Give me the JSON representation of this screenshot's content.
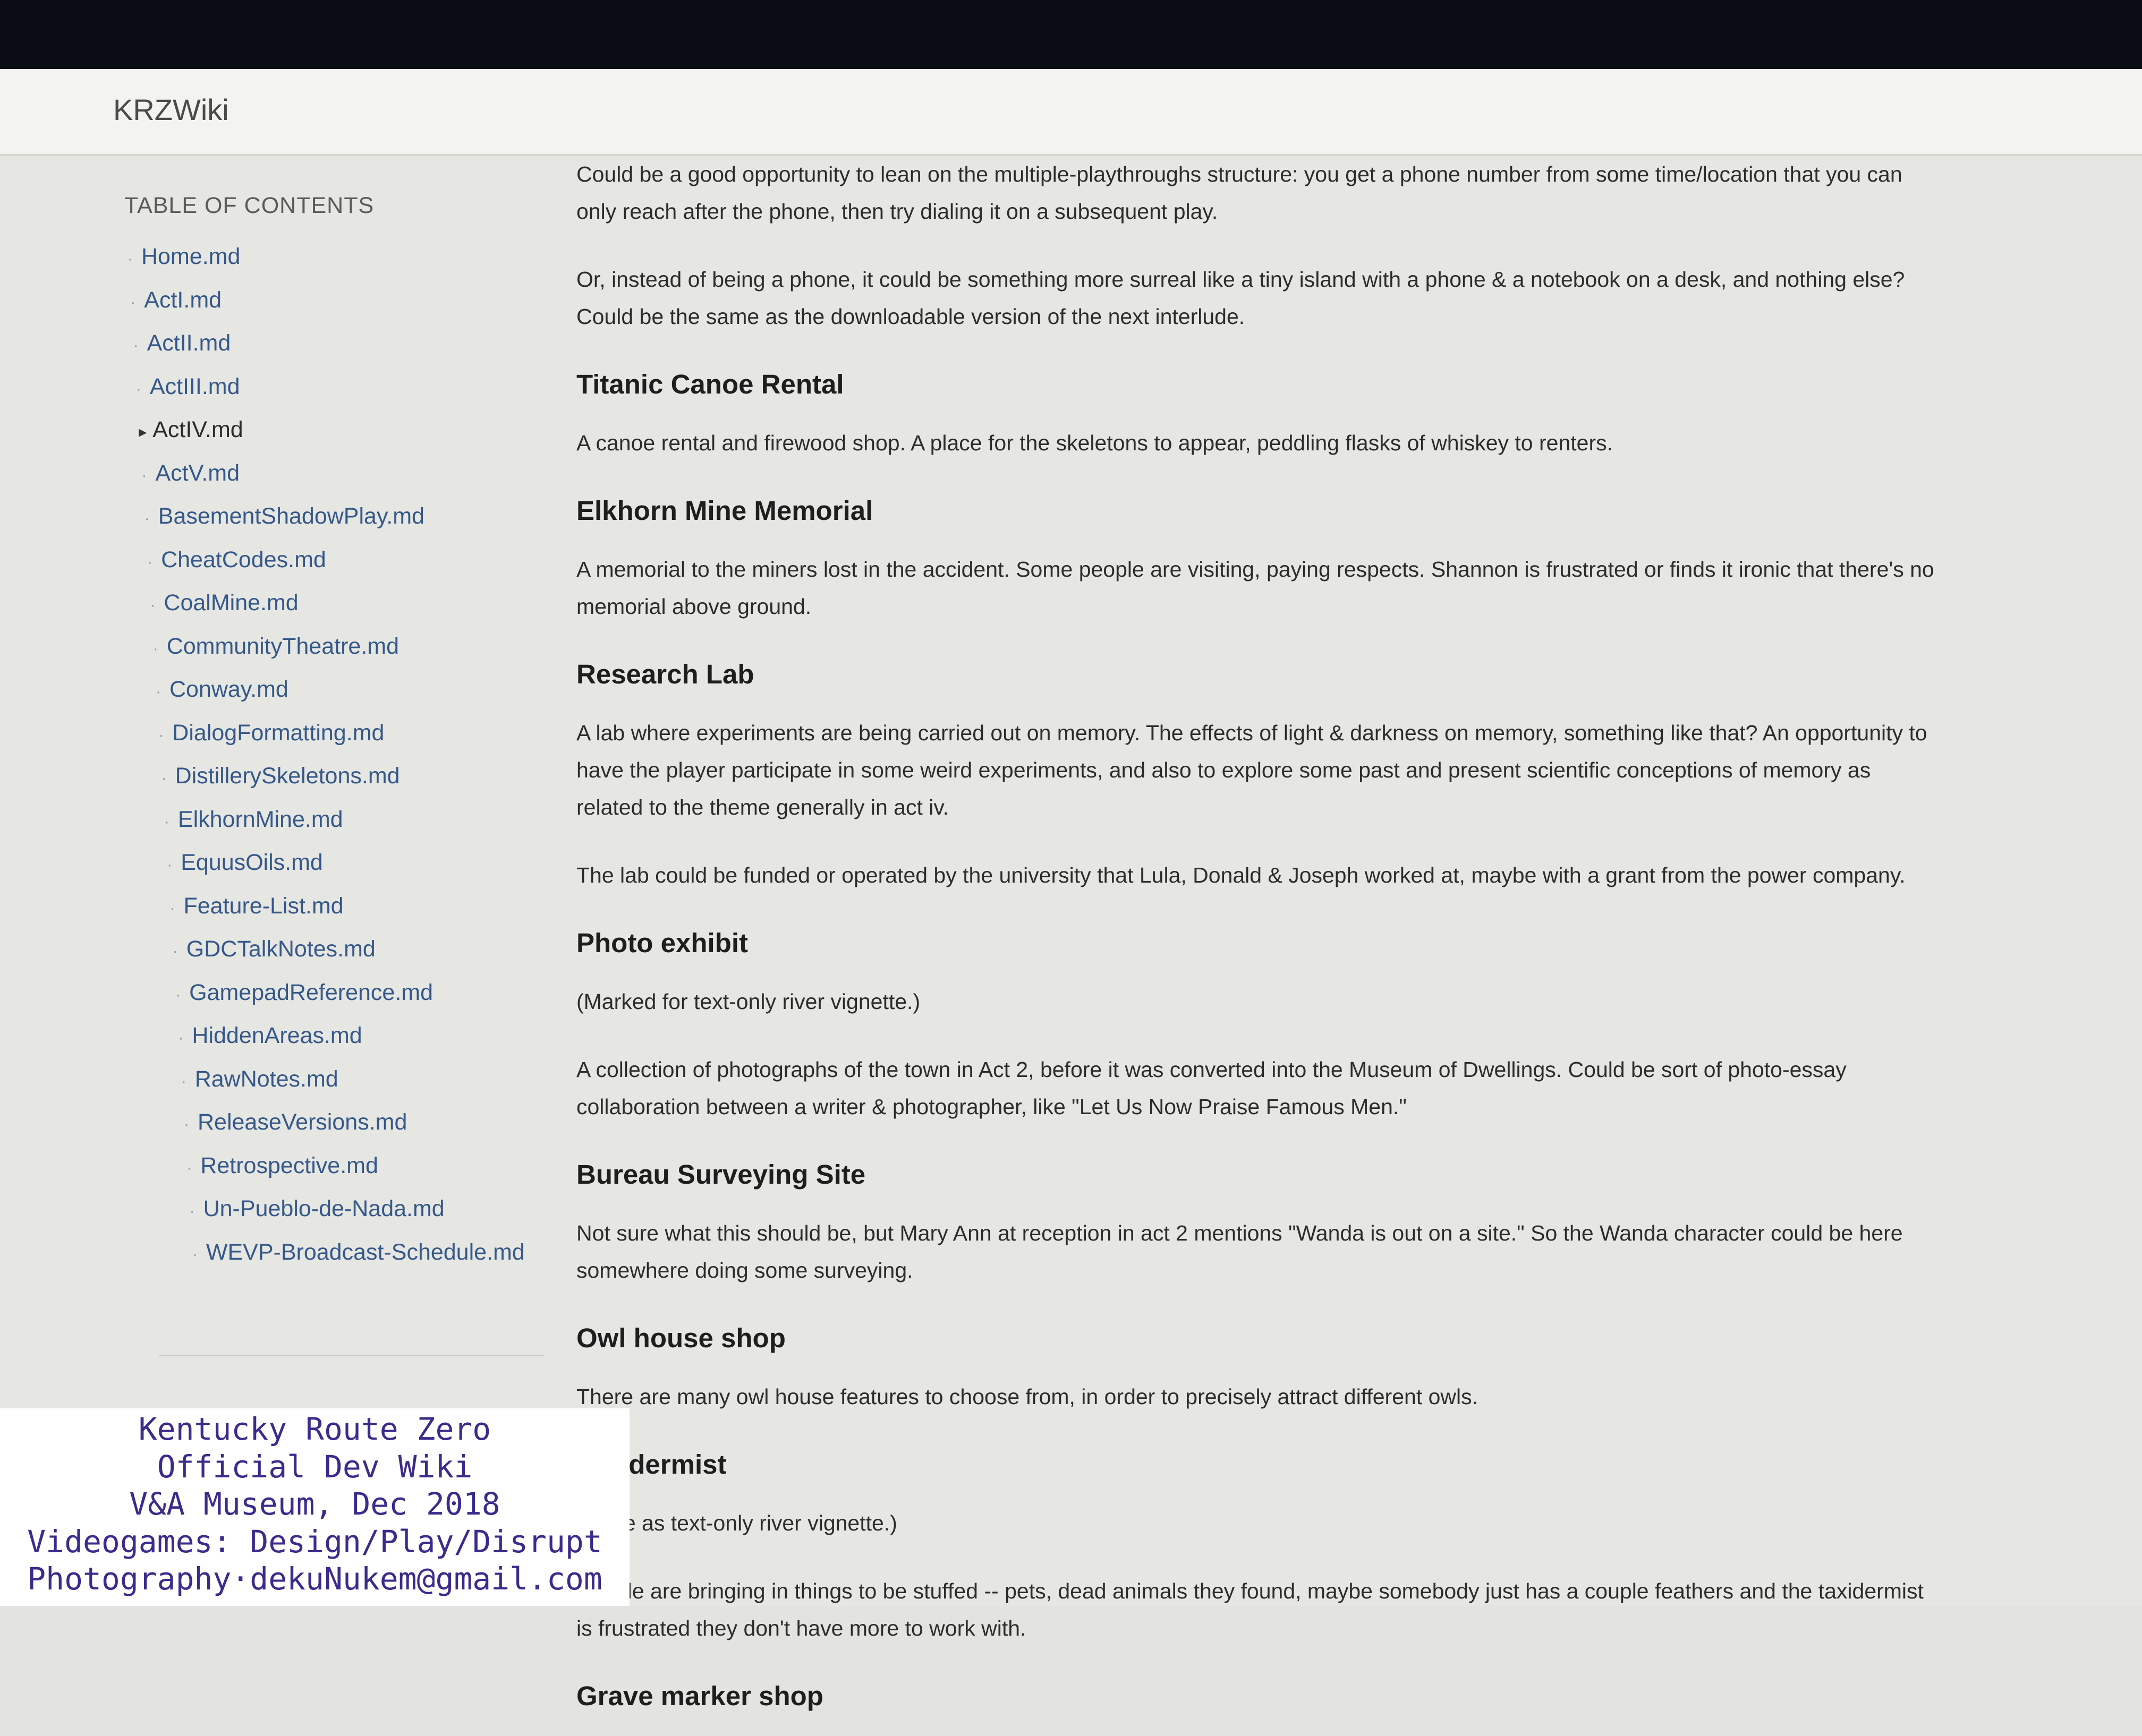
{
  "header": {
    "brand": "KRZWiki"
  },
  "sidebar": {
    "toc_heading": "TABLE OF CONTENTS",
    "items": [
      {
        "label": "Home.md"
      },
      {
        "label": "ActI.md"
      },
      {
        "label": "ActII.md"
      },
      {
        "label": "ActIII.md"
      },
      {
        "label": "ActIV.md",
        "active": true
      },
      {
        "label": "ActV.md"
      },
      {
        "label": "BasementShadowPlay.md"
      },
      {
        "label": "CheatCodes.md"
      },
      {
        "label": "CoalMine.md"
      },
      {
        "label": "CommunityTheatre.md"
      },
      {
        "label": "Conway.md"
      },
      {
        "label": "DialogFormatting.md"
      },
      {
        "label": "DistillerySkeletons.md"
      },
      {
        "label": "ElkhornMine.md"
      },
      {
        "label": "EquusOils.md"
      },
      {
        "label": "Feature-List.md"
      },
      {
        "label": "GDCTalkNotes.md"
      },
      {
        "label": "GamepadReference.md"
      },
      {
        "label": "HiddenAreas.md"
      },
      {
        "label": "RawNotes.md"
      },
      {
        "label": "ReleaseVersions.md"
      },
      {
        "label": "Retrospective.md"
      },
      {
        "label": "Un-Pueblo-de-Nada.md"
      },
      {
        "label": "WEVP-Broadcast-Schedule.md"
      }
    ]
  },
  "content": {
    "intro_p1": "Could be a good opportunity to lean on the multiple-playthroughs structure: you get a phone number from some time/location that you can only reach after the phone, then try dialing it on a subsequent play.",
    "intro_p2": "Or, instead of being a phone, it could be something more surreal like a tiny island with a phone & a notebook on a desk, and nothing else? Could be the same as the downloadable version of the next interlude.",
    "sections": [
      {
        "title": "Titanic Canoe Rental",
        "paragraphs": [
          "A canoe rental and firewood shop. A place for the skeletons to appear, peddling flasks of whiskey to renters."
        ]
      },
      {
        "title": "Elkhorn Mine Memorial",
        "paragraphs": [
          "A memorial to the miners lost in the accident. Some people are visiting, paying respects. Shannon is frustrated or finds it ironic that there's no memorial above ground."
        ]
      },
      {
        "title": "Research Lab",
        "paragraphs": [
          "A lab where experiments are being carried out on memory. The effects of light & darkness on memory, something like that? An opportunity to have the player participate in some weird experiments, and also to explore some past and present scientific conceptions of memory as related to the theme generally in act iv.",
          "The lab could be funded or operated by the university that Lula, Donald & Joseph worked at, maybe with a grant from the power company."
        ]
      },
      {
        "title": "Photo exhibit",
        "paragraphs": [
          "(Marked for text-only river vignette.)",
          "A collection of photographs of the town in Act 2, before it was converted into the Museum of Dwellings. Could be sort of photo-essay collaboration between a writer & photographer, like \"Let Us Now Praise Famous Men.\""
        ]
      },
      {
        "title": "Bureau Surveying Site",
        "paragraphs": [
          "Not sure what this should be, but Mary Ann at reception in act 2 mentions \"Wanda is out on a site.\" So the Wanda character could be here somewhere doing some surveying."
        ]
      },
      {
        "title": "Owl house shop",
        "paragraphs": [
          "There are many owl house features to choose from, in order to precisely attract different owls."
        ]
      },
      {
        "title": "Taxidermist",
        "paragraphs": [
          "(Done as text-only river vignette.)",
          "People are bringing in things to be stuffed -- pets, dead animals they found, maybe somebody just has a couple feathers and the taxidermist is frustrated they don't have more to work with."
        ]
      },
      {
        "title": "Grave marker shop",
        "paragraphs": []
      }
    ]
  },
  "watermark": {
    "lines": [
      "Kentucky Route Zero",
      "Official Dev Wiki",
      "V&A Museum, Dec 2018",
      "Videogames: Design/Play/Disrupt",
      "Photography·dekuNukem@gmail.com"
    ]
  }
}
